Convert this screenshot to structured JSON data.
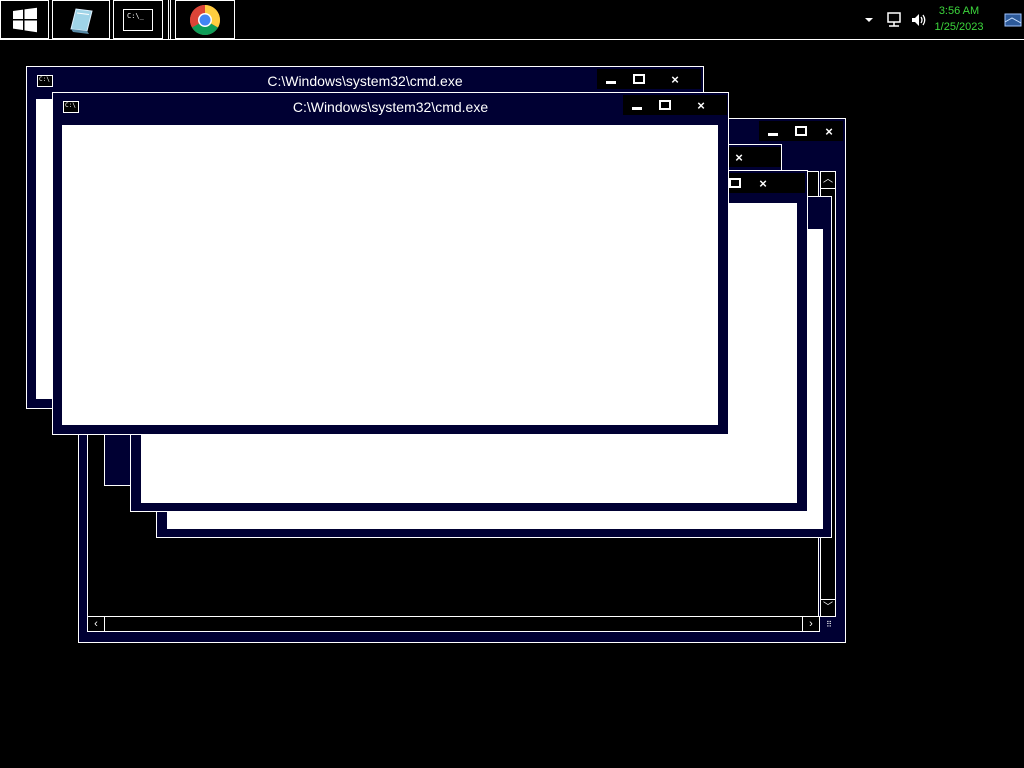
{
  "taskbar": {
    "start_icon": "windows-logo-icon",
    "pinned": [
      {
        "name": "server-manager",
        "icon": "server-manager-icon"
      },
      {
        "name": "command-prompt",
        "icon": "cmd-icon",
        "icon_text": "C:\\_"
      },
      {
        "name": "chrome",
        "icon": "chrome-icon"
      }
    ],
    "tray": {
      "chevron_icon": "show-hidden-icons-chevron-icon",
      "network_icon": "network-icon",
      "volume_icon": "speaker-icon",
      "time": "3:56 AM",
      "date": "1/25/2023",
      "show_desktop_icon": "show-desktop-icon"
    }
  },
  "windows": [
    {
      "title": "C:\\Windows\\system32\\cmd.exe",
      "icon_text": "C:\\"
    },
    {
      "title": "C:\\Windows\\system32\\cmd.exe",
      "icon_text": "C:\\"
    }
  ],
  "controls": {
    "minimize": "minimize-icon",
    "maximize": "maximize-icon",
    "close": "×"
  },
  "colors": {
    "window_frame": "#000033",
    "client": "#ffffff",
    "clock": "#3cd63c",
    "desktop": "#000000"
  }
}
